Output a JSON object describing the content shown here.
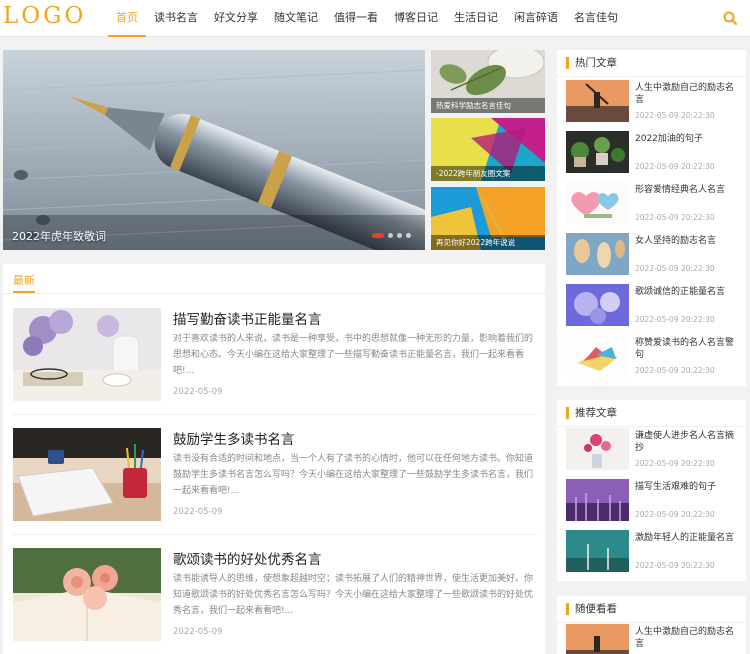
{
  "header": {
    "logo": "LOGO",
    "nav": [
      "首页",
      "读书名言",
      "好文分享",
      "随文笔记",
      "值得一看",
      "博客日记",
      "生活日记",
      "闲言碎语",
      "名言佳句"
    ],
    "active_index": 0,
    "accent_color": "#f2a41a",
    "search_icon": "search-icon"
  },
  "slider": {
    "caption": "2022年虎年致敬词",
    "dots": 4,
    "active_dot": 0,
    "side_items": [
      {
        "caption": "热爱科学励志名言佳句"
      },
      {
        "caption": "-2022跨年朋友圈文案"
      },
      {
        "caption": "再见你好2022跨年说说"
      }
    ]
  },
  "main": {
    "tab": "最新",
    "articles": [
      {
        "title": "描写勤奋读书正能量名言",
        "desc": "对于喜欢读书的人来说，读书是一种享受，书中的思想就像一种无形的力量，影响着我们的思想和心态。今天小编在这给大家整理了一些描写勤奋读书正能量名言，我们一起来看看吧!...",
        "date": "2022-05-09"
      },
      {
        "title": "鼓励学生多读书名言",
        "desc": "读书没有合适的时间和地点，当一个人有了读书的心情时，他可以在任何地方读书。你知道鼓励学生多读书名言怎么写吗？今天小编在这给大家整理了一些鼓励学生多读书名言，我们一起来看看吧!...",
        "date": "2022-05-09"
      },
      {
        "title": "歌颂读书的好处优秀名言",
        "desc": "读书能诱导人的思维，使想象超越时空；读书拓展了人们的精神世界，使生活更加美好。你知道歌颂读书的好处优秀名言怎么写吗？今天小编在这给大家整理了一些歌颂读书的好处优秀名言，我们一起来看看吧!...",
        "date": "2022-05-09"
      }
    ]
  },
  "sidebar": {
    "hot": {
      "title": "热门文章",
      "items": [
        {
          "title": "人生中激励自己的励志名言",
          "date": "2022-05-09 20:22:30"
        },
        {
          "title": "2022加油的句子",
          "date": "2022-05-09 20:22:30"
        },
        {
          "title": "形容爱情经典名人名言",
          "date": "2022-05-09 20:22:30"
        },
        {
          "title": "女人坚持的励志名言",
          "date": "2022-05-09 20:22:30"
        },
        {
          "title": "歌颂诚信的正能量名言",
          "date": "2022-05-09 20:22:30"
        },
        {
          "title": "称赞爱读书的名人名言警句",
          "date": "2022-05-09 20:22:30"
        }
      ]
    },
    "recommend": {
      "title": "推荐文章",
      "items": [
        {
          "title": "谦虚使人进步名人名言摘抄",
          "date": "2022-05-09 20:22:30"
        },
        {
          "title": "描写生活艰难的句子",
          "date": "2022-05-09 20:22:30"
        },
        {
          "title": "激励年轻人的正能量名言",
          "date": "2022-05-09 20:22:30"
        }
      ]
    },
    "random": {
      "title": "随便看看",
      "items": [
        {
          "title": "人生中激励自己的励志名言",
          "date": ""
        }
      ]
    }
  }
}
